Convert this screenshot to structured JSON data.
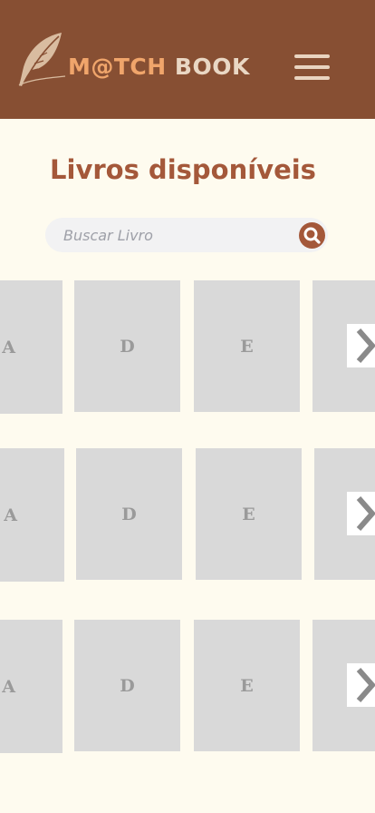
{
  "header": {
    "logo_part1": "M@TCH",
    "logo_part2": "BOOK",
    "menu_icon": "hamburger-menu-icon",
    "logo_icon": "feather-quill-icon"
  },
  "main": {
    "title": "Livros disponíveis",
    "search": {
      "placeholder": "Buscar Livro",
      "value": "",
      "icon": "search-icon"
    }
  },
  "shelves": [
    {
      "books": [
        "A",
        "D",
        "E",
        ""
      ],
      "next_icon": "chevron-right-icon"
    },
    {
      "books": [
        "A",
        "D",
        "E",
        ""
      ],
      "next_icon": "chevron-right-icon"
    },
    {
      "books": [
        "A",
        "D",
        "E",
        ""
      ],
      "next_icon": "chevron-right-icon"
    }
  ],
  "colors": {
    "header_bg": "#874f33",
    "page_bg": "#fefbef",
    "accent": "#a4583a",
    "logo_match": "#f0a56b",
    "logo_book": "#e9d7c4",
    "book_placeholder": "#d9d9d9"
  }
}
